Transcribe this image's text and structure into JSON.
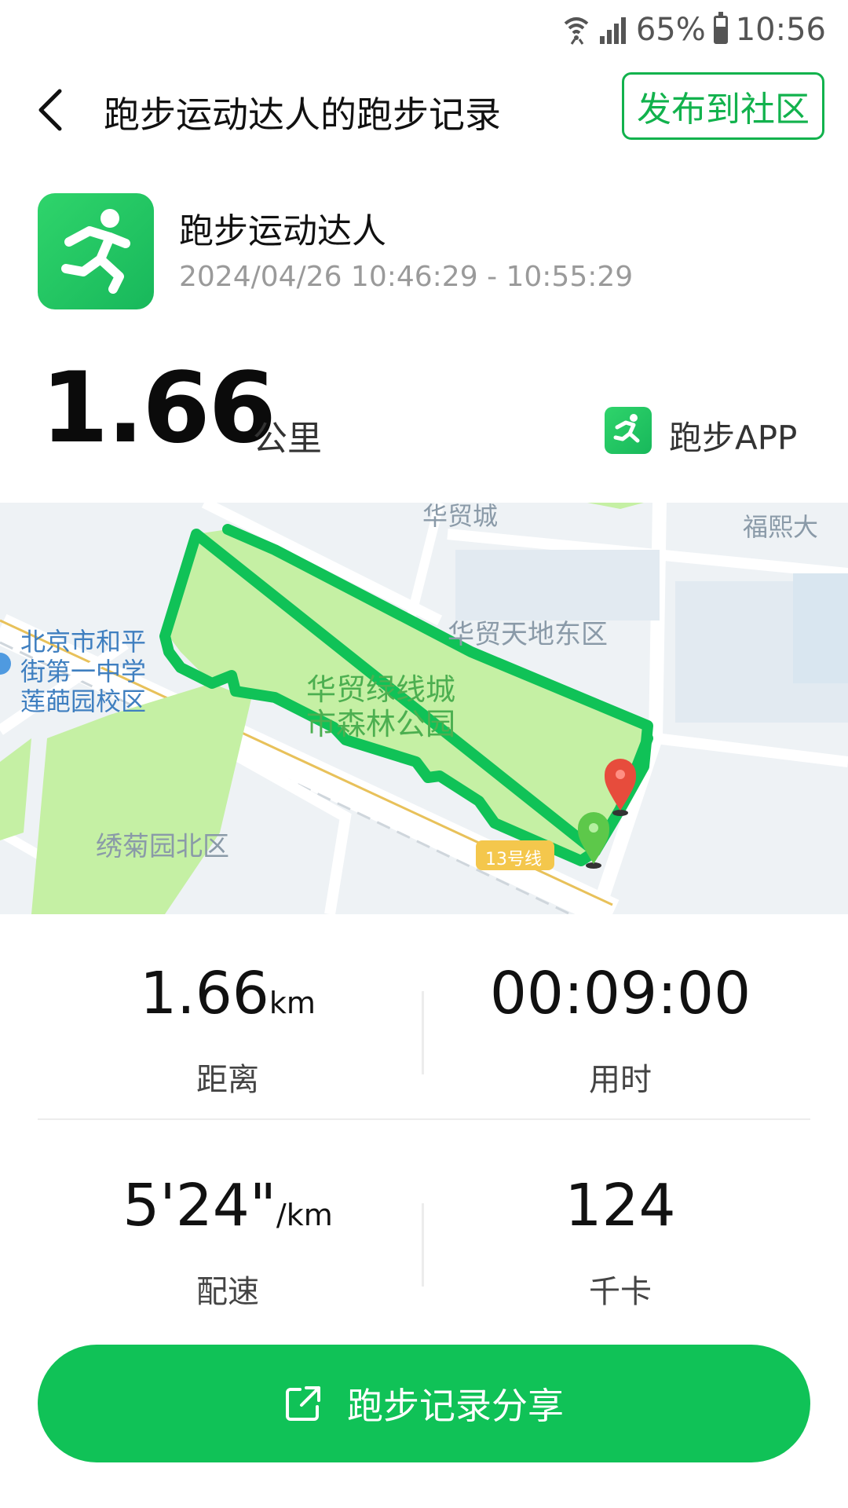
{
  "status_bar": {
    "battery_percent": "65%",
    "time": "10:56",
    "battery_level": 0.65
  },
  "header": {
    "title": "跑步运动达人的跑步记录",
    "publish_label": "发布到社区"
  },
  "profile": {
    "name": "跑步运动达人",
    "time_range": "2024/04/26  10:46:29 - 10:55:29"
  },
  "summary": {
    "distance": "1.66",
    "unit": "公里",
    "app_name": "跑步APP"
  },
  "map": {
    "labels": {
      "top_left": "华贸城",
      "top_right": "福熙大",
      "school_line1": "北京市和平",
      "school_line2": "街第一中学",
      "school_line3": "莲葩园校区",
      "east_area": "华贸天地东区",
      "park_line1": "华贸绿线城",
      "park_line2": "市森林公园",
      "north_area": "绣菊园北区",
      "subway": "13号线"
    },
    "route_color": "#10c257",
    "park_color": "#c5f0a4"
  },
  "stats": {
    "distance_value": "1.66",
    "distance_unit": "km",
    "distance_label": "距离",
    "duration_value": "00:09:00",
    "duration_label": "用时",
    "pace_value": "5'24\"",
    "pace_unit": "/km",
    "pace_label": "配速",
    "calories_value": "124",
    "calories_label": "千卡"
  },
  "share": {
    "label": "跑步记录分享"
  }
}
